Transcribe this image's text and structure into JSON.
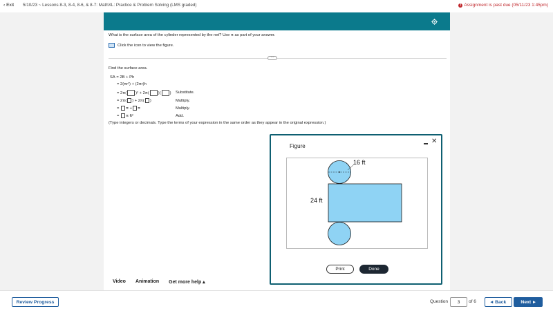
{
  "header": {
    "exit_label": "Exit",
    "breadcrumb": "5/10/23 ~ Lessons 8-3, 8-4, 8-6, & 8-7: MathXL: Practice & Problem Solving (LMS graded)",
    "past_due": "Assignment is past due (05/11/23 1:45pm)"
  },
  "question": {
    "prompt": "What is the surface area of the cylinder represented by the net? Use π as part of your answer.",
    "figure_link": "Click the icon to view the figure.",
    "instruction": "Find the surface area.",
    "rows": [
      {
        "lhs": "SA",
        "eq": "=",
        "expr": "2B + Ph",
        "note": ""
      },
      {
        "eq": "=",
        "expr": "2(πr²) + (2πr)h",
        "note": ""
      },
      {
        "eq": "=",
        "expr_a": "2π(",
        "expr_b": ")² + 2π(",
        "expr_c": ")(",
        "expr_d": ")",
        "note": "Substitute."
      },
      {
        "eq": "=",
        "expr_a": "2π(",
        "expr_b": ") + 2π(",
        "expr_c": ")",
        "note": "Multiply."
      },
      {
        "eq": "=",
        "expr_a": "π +",
        "expr_b": "π",
        "note": "Multiply."
      },
      {
        "eq": "=",
        "expr_a": "π ft²",
        "note": "Add."
      }
    ],
    "hint": "(Type integers or decimals. Type the terms of your expression in the same order as they appear in the original expression.)"
  },
  "help": {
    "video": "Video",
    "animation": "Animation",
    "more_help": "Get more help ▴"
  },
  "footer": {
    "review_label": "Review Progress",
    "question_label": "Question",
    "question_number": "3",
    "of_total": "of 6",
    "back_label": "Back",
    "next_label": "Next"
  },
  "figure_modal": {
    "title": "Figure",
    "radius_label": "16 ft",
    "height_label": "24 ft",
    "print_label": "Print",
    "done_label": "Done"
  },
  "colors": {
    "teal": "#0b7a8c",
    "accent_blue": "#1f5d9e",
    "alert_red": "#c0282d",
    "shape_fill": "#8fd3f4"
  }
}
